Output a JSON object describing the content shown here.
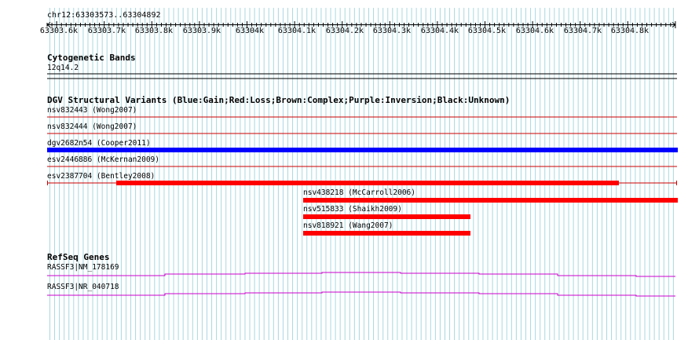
{
  "ruler": {
    "region": "chr12:63303573..63304892",
    "ticks": [
      "63303.6k",
      "63303.7k",
      "63303.8k",
      "63303.9k",
      "63304k",
      "63304.1k",
      "63304.2k",
      "63304.3k",
      "63304.4k",
      "63304.5k",
      "63304.6k",
      "63304.7k",
      "63304.8k"
    ]
  },
  "cytobands": {
    "title": "Cytogenetic Bands",
    "band": "12q14.2"
  },
  "dgv": {
    "title": "DGV Structural Variants (Blue:Gain;Red:Loss;Brown:Complex;Purple:Inversion;Black:Unknown)",
    "colors": {
      "gain": "#0000ff",
      "loss": "#ff0000",
      "thin_line": "#cc0000"
    },
    "features": [
      {
        "label": "nsv832443 (Wong2007)",
        "type": "loss"
      },
      {
        "label": "nsv832444 (Wong2007)",
        "type": "loss"
      },
      {
        "label": "dgv2682n54 (Cooper2011)",
        "type": "gain"
      },
      {
        "label": "esv2446886 (McKernan2009)",
        "type": "loss"
      },
      {
        "label": "esv2387704 (Bentley2008)",
        "type": "loss"
      },
      {
        "label": "nsv438218 (McCarroll2006)",
        "type": "loss"
      },
      {
        "label": "nsv515833 (Shaikh2009)",
        "type": "loss"
      },
      {
        "label": "nsv818921 (Wang2007)",
        "type": "loss"
      }
    ]
  },
  "refseq": {
    "title": "RefSeq Genes",
    "color": "#cc00cc",
    "genes": [
      {
        "label": "RASSF3|NM_178169"
      },
      {
        "label": "RASSF3|NR_040718"
      }
    ]
  },
  "colors": {
    "grid": "#a8d8e0",
    "text": "#000000"
  }
}
